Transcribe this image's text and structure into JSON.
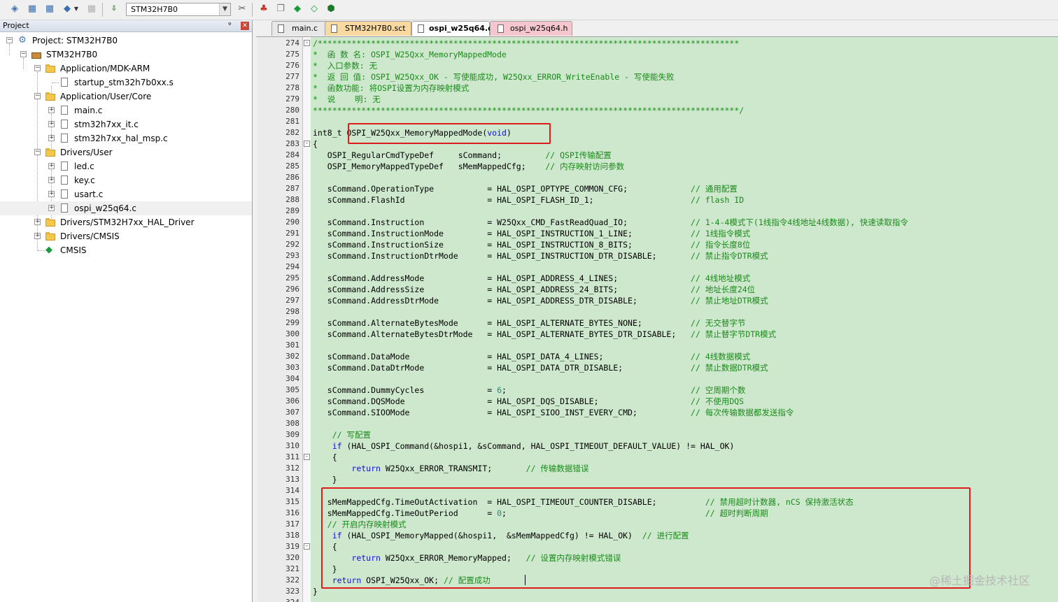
{
  "toolbar": {
    "target": "STM32H7B0",
    "icons": [
      "translate-icon",
      "build-icon",
      "rebuild-icon",
      "batch-build-icon",
      "stop-build-icon",
      "download-icon",
      "target-options-icon",
      "manage-components-icon",
      "file-extensions-icon",
      "select-pack-icon",
      "green-diamond-icon",
      "pack-installer-icon"
    ]
  },
  "project_panel": {
    "title": "Project",
    "tree": [
      {
        "label": "Project: STM32H7B0",
        "kind": "project"
      },
      {
        "label": "STM32H7B0",
        "kind": "target"
      },
      {
        "label": "Application/MDK-ARM",
        "kind": "folder"
      },
      {
        "label": "startup_stm32h7b0xx.s",
        "kind": "file"
      },
      {
        "label": "Application/User/Core",
        "kind": "folder"
      },
      {
        "label": "main.c",
        "kind": "file"
      },
      {
        "label": "stm32h7xx_it.c",
        "kind": "file"
      },
      {
        "label": "stm32h7xx_hal_msp.c",
        "kind": "file"
      },
      {
        "label": "Drivers/User",
        "kind": "folder"
      },
      {
        "label": "led.c",
        "kind": "file"
      },
      {
        "label": "key.c",
        "kind": "file"
      },
      {
        "label": "usart.c",
        "kind": "file"
      },
      {
        "label": "ospi_w25q64.c",
        "kind": "file",
        "selected": true
      },
      {
        "label": "Drivers/STM32H7xx_HAL_Driver",
        "kind": "folder"
      },
      {
        "label": "Drivers/CMSIS",
        "kind": "folder"
      },
      {
        "label": "CMSIS",
        "kind": "cmsis"
      }
    ]
  },
  "tabs": [
    {
      "label": "main.c",
      "style": "main"
    },
    {
      "label": "STM32H7B0.sct",
      "style": "sct"
    },
    {
      "label": "ospi_w25q64.c",
      "style": "active"
    },
    {
      "label": "ospi_w25q64.h",
      "style": "hdr"
    }
  ],
  "editor": {
    "lines": [
      {
        "n": "274",
        "fold": "-",
        "segs": [
          [
            "cm",
            "/***************************************************************************************"
          ]
        ]
      },
      {
        "n": "275",
        "segs": [
          [
            "cm",
            "*  函 数 名: OSPI_W25Qxx_MemoryMappedMode"
          ]
        ]
      },
      {
        "n": "276",
        "segs": [
          [
            "cm",
            "*  入口参数: 无"
          ]
        ]
      },
      {
        "n": "277",
        "segs": [
          [
            "cm",
            "*  返 回 值: OSPI_W25Qxx_OK - 写使能成功, W25Qxx_ERROR_WriteEnable - 写使能失败"
          ]
        ]
      },
      {
        "n": "278",
        "segs": [
          [
            "cm",
            "*  函数功能: 将OSPI设置为内存映射模式"
          ]
        ]
      },
      {
        "n": "279",
        "segs": [
          [
            "cm",
            "*  说    明: 无"
          ]
        ]
      },
      {
        "n": "280",
        "segs": [
          [
            "cm",
            "****************************************************************************************/"
          ]
        ]
      },
      {
        "n": "281",
        "segs": []
      },
      {
        "n": "282",
        "segs": [
          [
            "",
            "int8_t OSPI_W25Qxx_MemoryMappedMode("
          ],
          [
            "kw",
            "void"
          ],
          [
            "",
            ")"
          ]
        ]
      },
      {
        "n": "283",
        "fold": "-",
        "segs": [
          [
            "",
            "{"
          ]
        ]
      },
      {
        "n": "284",
        "segs": [
          [
            "",
            "   OSPI_RegularCmdTypeDef     sCommand;         "
          ],
          [
            "cm",
            "// QSPI传输配置"
          ]
        ]
      },
      {
        "n": "285",
        "segs": [
          [
            "",
            "   OSPI_MemoryMappedTypeDef   sMemMappedCfg;    "
          ],
          [
            "cm",
            "// 内存映射访问参数"
          ]
        ]
      },
      {
        "n": "286",
        "segs": []
      },
      {
        "n": "287",
        "segs": [
          [
            "",
            "   sCommand.OperationType           = HAL_OSPI_OPTYPE_COMMON_CFG;             "
          ],
          [
            "cm",
            "// 通用配置"
          ]
        ]
      },
      {
        "n": "288",
        "segs": [
          [
            "",
            "   sCommand.FlashId                 = HAL_OSPI_FLASH_ID_1;                    "
          ],
          [
            "cm",
            "// flash ID"
          ]
        ]
      },
      {
        "n": "289",
        "segs": []
      },
      {
        "n": "290",
        "segs": [
          [
            "",
            "   sCommand.Instruction             = W25Qxx_CMD_FastReadQuad_IO;             "
          ],
          [
            "cm",
            "// 1-4-4模式下(1线指令4线地址4线数据), 快速读取指令"
          ]
        ]
      },
      {
        "n": "291",
        "segs": [
          [
            "",
            "   sCommand.InstructionMode         = HAL_OSPI_INSTRUCTION_1_LINE;            "
          ],
          [
            "cm",
            "// 1线指令模式"
          ]
        ]
      },
      {
        "n": "292",
        "segs": [
          [
            "",
            "   sCommand.InstructionSize         = HAL_OSPI_INSTRUCTION_8_BITS;            "
          ],
          [
            "cm",
            "// 指令长度8位"
          ]
        ]
      },
      {
        "n": "293",
        "segs": [
          [
            "",
            "   sCommand.InstructionDtrMode      = HAL_OSPI_INSTRUCTION_DTR_DISABLE;       "
          ],
          [
            "cm",
            "// 禁止指令DTR模式"
          ]
        ]
      },
      {
        "n": "294",
        "segs": []
      },
      {
        "n": "295",
        "segs": [
          [
            "",
            "   sCommand.AddressMode             = HAL_OSPI_ADDRESS_4_LINES;               "
          ],
          [
            "cm",
            "// 4线地址模式"
          ]
        ]
      },
      {
        "n": "296",
        "segs": [
          [
            "",
            "   sCommand.AddressSize             = HAL_OSPI_ADDRESS_24_BITS;               "
          ],
          [
            "cm",
            "// 地址长度24位"
          ]
        ]
      },
      {
        "n": "297",
        "segs": [
          [
            "",
            "   sCommand.AddressDtrMode          = HAL_OSPI_ADDRESS_DTR_DISABLE;           "
          ],
          [
            "cm",
            "// 禁止地址DTR模式"
          ]
        ]
      },
      {
        "n": "298",
        "segs": []
      },
      {
        "n": "299",
        "segs": [
          [
            "",
            "   sCommand.AlternateBytesMode      = HAL_OSPI_ALTERNATE_BYTES_NONE;          "
          ],
          [
            "cm",
            "// 无交替字节"
          ]
        ]
      },
      {
        "n": "300",
        "segs": [
          [
            "",
            "   sCommand.AlternateBytesDtrMode   = HAL_OSPI_ALTERNATE_BYTES_DTR_DISABLE;   "
          ],
          [
            "cm",
            "// 禁止替字节DTR模式"
          ]
        ]
      },
      {
        "n": "301",
        "segs": []
      },
      {
        "n": "302",
        "segs": [
          [
            "",
            "   sCommand.DataMode                = HAL_OSPI_DATA_4_LINES;                  "
          ],
          [
            "cm",
            "// 4线数据模式"
          ]
        ]
      },
      {
        "n": "303",
        "segs": [
          [
            "",
            "   sCommand.DataDtrMode             = HAL_OSPI_DATA_DTR_DISABLE;              "
          ],
          [
            "cm",
            "// 禁止数据DTR模式"
          ]
        ]
      },
      {
        "n": "304",
        "segs": []
      },
      {
        "n": "305",
        "segs": [
          [
            "",
            "   sCommand.DummyCycles             = "
          ],
          [
            "num",
            "6"
          ],
          [
            "",
            ";                                      "
          ],
          [
            "cm",
            "// 空周期个数"
          ]
        ]
      },
      {
        "n": "306",
        "segs": [
          [
            "",
            "   sCommand.DQSMode                 = HAL_OSPI_DQS_DISABLE;                   "
          ],
          [
            "cm",
            "// 不使用DQS"
          ]
        ]
      },
      {
        "n": "307",
        "segs": [
          [
            "",
            "   sCommand.SIOOMode                = HAL_OSPI_SIOO_INST_EVERY_CMD;           "
          ],
          [
            "cm",
            "// 每次传输数据都发送指令"
          ]
        ]
      },
      {
        "n": "308",
        "segs": []
      },
      {
        "n": "309",
        "segs": [
          [
            "",
            "    "
          ],
          [
            "cm",
            "// 写配置"
          ]
        ]
      },
      {
        "n": "310",
        "segs": [
          [
            "",
            "    "
          ],
          [
            "kw",
            "if"
          ],
          [
            "",
            " (HAL_OSPI_Command(&hospi1, &sCommand, HAL_OSPI_TIMEOUT_DEFAULT_VALUE) != HAL_OK)"
          ]
        ]
      },
      {
        "n": "311",
        "fold": "-",
        "segs": [
          [
            "",
            "    {"
          ]
        ]
      },
      {
        "n": "312",
        "segs": [
          [
            "",
            "        "
          ],
          [
            "kw",
            "return"
          ],
          [
            "",
            " W25Qxx_ERROR_TRANSMIT;       "
          ],
          [
            "cm",
            "// 传输数据错误"
          ]
        ]
      },
      {
        "n": "313",
        "segs": [
          [
            "",
            "    }"
          ]
        ]
      },
      {
        "n": "314",
        "segs": []
      },
      {
        "n": "315",
        "segs": [
          [
            "",
            "   sMemMappedCfg.TimeOutActivation  = HAL_OSPI_TIMEOUT_COUNTER_DISABLE;          "
          ],
          [
            "cm",
            "// 禁用超时计数器, nCS 保持激活状态"
          ]
        ]
      },
      {
        "n": "316",
        "segs": [
          [
            "",
            "   sMemMappedCfg.TimeOutPeriod      = "
          ],
          [
            "num",
            "0"
          ],
          [
            "",
            ";                                         "
          ],
          [
            "cm",
            "// 超时判断周期"
          ]
        ]
      },
      {
        "n": "317",
        "segs": [
          [
            "cm",
            "   // 开启内存映射模式"
          ]
        ]
      },
      {
        "n": "318",
        "segs": [
          [
            "",
            "    "
          ],
          [
            "kw",
            "if"
          ],
          [
            "",
            " (HAL_OSPI_MemoryMapped(&hospi1,  &sMemMappedCfg) != HAL_OK)  "
          ],
          [
            "cm",
            "// 进行配置"
          ]
        ]
      },
      {
        "n": "319",
        "fold": "-",
        "segs": [
          [
            "",
            "    {"
          ]
        ]
      },
      {
        "n": "320",
        "segs": [
          [
            "",
            "        "
          ],
          [
            "kw",
            "return"
          ],
          [
            "",
            " W25Qxx_ERROR_MemoryMapped;   "
          ],
          [
            "cm",
            "// 设置内存映射模式错误"
          ]
        ]
      },
      {
        "n": "321",
        "segs": [
          [
            "",
            "    }"
          ]
        ]
      },
      {
        "n": "322",
        "segs": [
          [
            "",
            "    "
          ],
          [
            "kw",
            "return"
          ],
          [
            "",
            " OSPI_W25Qxx_OK; "
          ],
          [
            "cm",
            "// 配置成功"
          ]
        ]
      },
      {
        "n": "323",
        "segs": [
          [
            "",
            "}"
          ]
        ]
      },
      {
        "n": "324",
        "segs": []
      }
    ]
  },
  "watermark": "@稀土掘金技术社区"
}
